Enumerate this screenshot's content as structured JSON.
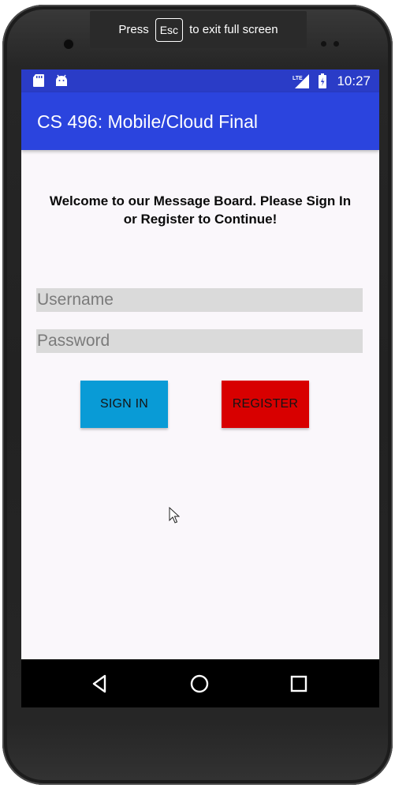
{
  "fullscreen_banner": {
    "press": "Press",
    "key": "Esc",
    "suffix": "to exit full screen"
  },
  "status_bar": {
    "time": "10:27",
    "network": "LTE",
    "left_icons": [
      "sd-card-icon",
      "android-icon"
    ],
    "right_icons": [
      "lte-signal-icon",
      "battery-icon"
    ]
  },
  "app_bar": {
    "title": "CS 496: Mobile/Cloud Final"
  },
  "main": {
    "welcome_line1": "Welcome to our Message Board. Please Sign In",
    "welcome_line2": "or Register to Continue!",
    "username_placeholder": "Username",
    "password_placeholder": "Password",
    "sign_in_label": "SIGN IN",
    "register_label": "REGISTER"
  },
  "nav_bar": {
    "icons": [
      "back-icon",
      "home-icon",
      "recents-icon"
    ]
  },
  "colors": {
    "status_bar": "#2a3cc7",
    "app_bar": "#2b44de",
    "screen_background": "#faf7fb",
    "input_background": "#dadada",
    "sign_in_button": "#099bd6",
    "register_button": "#d80000",
    "nav_bar": "#000000"
  }
}
